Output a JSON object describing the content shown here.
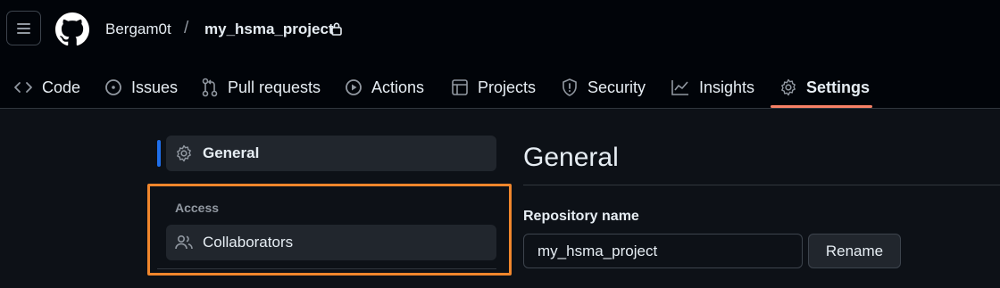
{
  "header": {
    "owner": "Bergam0t",
    "separator": "/",
    "repo_name": "my_hsma_project"
  },
  "tabs": [
    {
      "label": "Code",
      "icon": "code-icon"
    },
    {
      "label": "Issues",
      "icon": "issue-icon"
    },
    {
      "label": "Pull requests",
      "icon": "pull-request-icon"
    },
    {
      "label": "Actions",
      "icon": "play-icon"
    },
    {
      "label": "Projects",
      "icon": "table-icon"
    },
    {
      "label": "Security",
      "icon": "shield-icon"
    },
    {
      "label": "Insights",
      "icon": "graph-icon"
    },
    {
      "label": "Settings",
      "icon": "gear-icon",
      "active": true
    }
  ],
  "sidebar": {
    "general_label": "General",
    "access_section": "Access",
    "collaborators_label": "Collaborators"
  },
  "main": {
    "title": "General",
    "repo_name_label": "Repository name",
    "repo_name_value": "my_hsma_project",
    "rename_label": "Rename"
  },
  "colors": {
    "background": "#0d1117",
    "header": "#010409",
    "active_tab_underline": "#f78166",
    "selected_marker": "#1f6feb",
    "highlight_box": "#f0862c"
  }
}
